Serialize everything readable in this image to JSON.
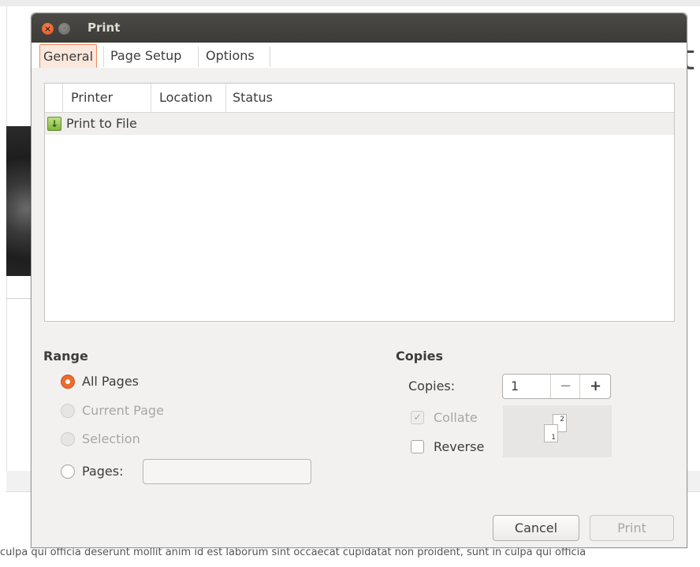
{
  "background": {
    "heading_fragment": "t",
    "lorem": "culpa qui officia deserunt mollit anim id est laborum sint occaecat cupidatat non proident, sunt in culpa qui officia"
  },
  "dialog": {
    "title": "Print",
    "tabs": [
      {
        "label": "General",
        "active": true
      },
      {
        "label": "Page Setup",
        "active": false
      },
      {
        "label": "Options",
        "active": false
      }
    ],
    "printer_table": {
      "columns": [
        "Printer",
        "Location",
        "Status"
      ],
      "rows": [
        {
          "icon": "download-icon",
          "printer": "Print to File",
          "location": "",
          "status": ""
        }
      ]
    },
    "range": {
      "title": "Range",
      "options": [
        {
          "label": "All Pages",
          "checked": true,
          "enabled": true
        },
        {
          "label": "Current Page",
          "checked": false,
          "enabled": false
        },
        {
          "label": "Selection",
          "checked": false,
          "enabled": false
        },
        {
          "label": "Pages:",
          "checked": false,
          "enabled": true
        }
      ],
      "pages_value": ""
    },
    "copies": {
      "title": "Copies",
      "label": "Copies:",
      "value": "1",
      "minus": "−",
      "plus": "+",
      "collate": {
        "label": "Collate",
        "checked": true,
        "enabled": false
      },
      "reverse": {
        "label": "Reverse",
        "checked": false,
        "enabled": true
      },
      "preview_pages": [
        "1",
        "2"
      ]
    },
    "buttons": {
      "cancel": "Cancel",
      "print": "Print"
    },
    "colors": {
      "accent": "#ee6b2f",
      "titlebar": "#3c3b37"
    }
  }
}
